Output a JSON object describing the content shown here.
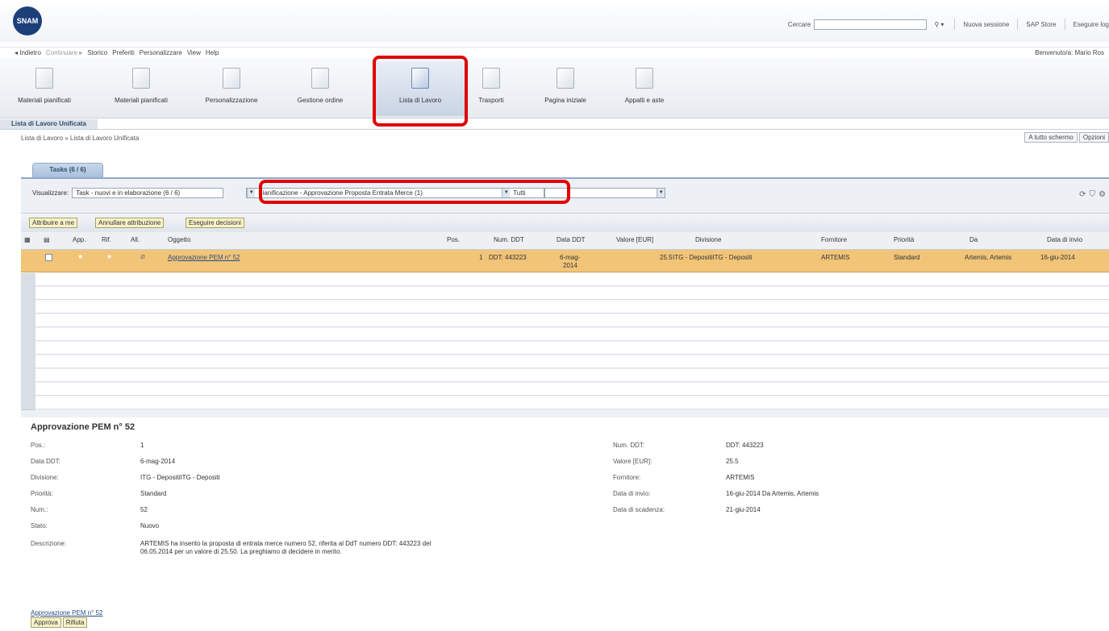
{
  "header": {
    "logo_text": "SNAM",
    "search_label": "Cercare",
    "search_value": "",
    "search_icon": "search-icon",
    "links": [
      "Nuova sessione",
      "SAP Store",
      "Eseguire log"
    ]
  },
  "menubar": {
    "items": [
      "◂ Indietro",
      "Continuare ▸",
      "Storico",
      "Preferiti",
      "Personalizzare",
      "View",
      "Help"
    ],
    "welcome": "Benvenuto/a: Mario Ros"
  },
  "toolbar": {
    "tiles": [
      {
        "label": "Materiali pianificati",
        "icon": "folder-icon"
      },
      {
        "label": "Materiali pianificati",
        "icon": "folder-icon"
      },
      {
        "label": "Personalizzazione",
        "icon": "folder-icon"
      },
      {
        "label": "Gestione ordine",
        "icon": "folder-icon"
      },
      {
        "label": "Lista di Lavoro",
        "icon": "open-folder-icon"
      },
      {
        "label": "Trasporti",
        "icon": "folder-icon"
      },
      {
        "label": "Pagina iniziale",
        "icon": "folder-icon"
      },
      {
        "label": "Appalti e aste",
        "icon": "folder-icon"
      }
    ]
  },
  "page": {
    "title": "Lista di Lavoro Unificata",
    "breadcrumb": "Lista di Lavoro  »  Lista di Lavoro Unificata",
    "fullscreen_btn": "A tutto schermo",
    "options_btn": "Opzioni"
  },
  "tab": {
    "label": "Tasks (6 / 6)"
  },
  "filters": {
    "show_label": "Visualizzare:",
    "view_value": "Task - nuovi e in elaborazione  (6 / 6)",
    "category_value": "Pianificazione - Approvazione Proposta Entrata Merce  (1)",
    "scope_value": "Tutti"
  },
  "actions": {
    "assign": "Attribuire a me",
    "cancel_assign": "Annullare attribuzione",
    "decide": "Eseguire decisioni"
  },
  "table": {
    "headers": [
      "App.",
      "Rif.",
      "All.",
      "Oggetto",
      "Pos.",
      "Num. DDT",
      "Data DDT",
      "Valore [EUR]",
      "Divisione",
      "Fornitore",
      "Priorità",
      "Da",
      "Data di invio"
    ],
    "rows": [
      {
        "oggetto": "Approvazione PEM n° 52",
        "pos": "1",
        "num_ddt": "DDT: 443223",
        "data_ddt_line1": "6-mag-",
        "data_ddt_line2": "2014",
        "valore": "25.5",
        "divisione": "ITG - DepositiITG - Depositi",
        "fornitore": "ARTEMIS",
        "priorita": "Standard",
        "da": "Artemis, Artemis",
        "data_invio": "16-giu-2014"
      }
    ]
  },
  "detail": {
    "title": "Approvazione PEM n° 52",
    "left": [
      {
        "label": "Pos.:",
        "value": "1"
      },
      {
        "label": "Data DDT:",
        "value": "6-mag-2014"
      },
      {
        "label": "Divisione:",
        "value": "ITG - DepositiITG - Depositi"
      },
      {
        "label": "Priorità:",
        "value": "Standard"
      },
      {
        "label": "Num.:",
        "value": "52"
      },
      {
        "label": "Stato:",
        "value": "Nuovo"
      }
    ],
    "description_label": "Descrizione:",
    "description": "ARTEMIS ha inserito la proposta di entrata merce numero 52, riferita al DdT numero DDT: 443223 del 06.05.2014 per un valore di 25.50. La preghiamo di decidere in merito.",
    "right": [
      {
        "label": "Num. DDT:",
        "value": "DDT: 443223"
      },
      {
        "label": "Valore [EUR]:",
        "value": "25.5"
      },
      {
        "label": "Fornitore:",
        "value": "ARTEMIS"
      },
      {
        "label": "Data di invio:",
        "value": "16-giu-2014 Da Artemis, Artemis"
      },
      {
        "label": "Data di scadenza:",
        "value": "21-giu-2014"
      }
    ],
    "decision_label": "Approvazione PEM n° 52",
    "approve": "Approva",
    "reject": "Rifiuta"
  }
}
